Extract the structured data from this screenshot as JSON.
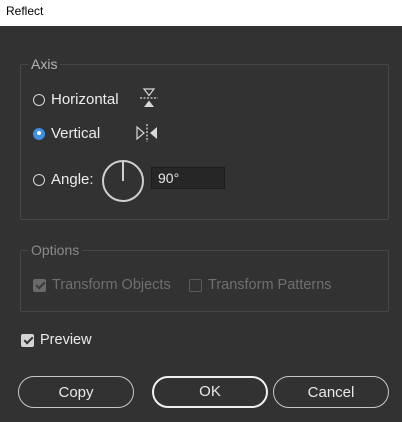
{
  "window": {
    "title": "Reflect"
  },
  "axis": {
    "legend": "Axis",
    "options": [
      {
        "label": "Horizontal",
        "checked": false,
        "icon": "reflect-horizontal-icon"
      },
      {
        "label": "Vertical",
        "checked": true,
        "icon": "reflect-vertical-icon"
      },
      {
        "label": "Angle:",
        "checked": false,
        "icon": "angle-dial-icon"
      }
    ],
    "angle_value": "90°"
  },
  "options": {
    "legend": "Options",
    "transform_objects": {
      "label": "Transform Objects",
      "checked": true,
      "disabled": true
    },
    "transform_patterns": {
      "label": "Transform Patterns",
      "checked": false,
      "disabled": true
    }
  },
  "preview": {
    "label": "Preview",
    "checked": true
  },
  "buttons": {
    "copy": "Copy",
    "ok": "OK",
    "cancel": "Cancel"
  },
  "colors": {
    "background": "#323232",
    "accent": "#3d8fe0",
    "titlebar": "#ffffff"
  }
}
